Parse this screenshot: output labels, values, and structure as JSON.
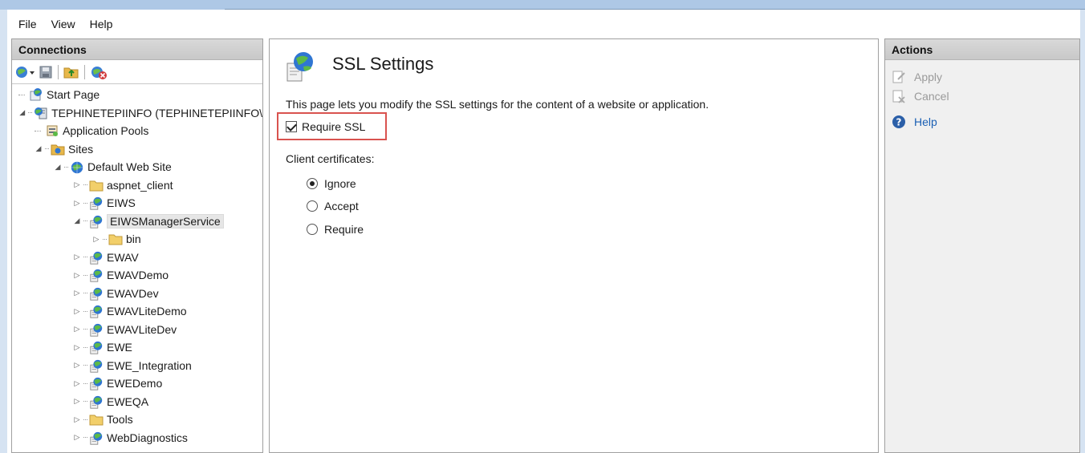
{
  "menu": [
    "File",
    "View",
    "Help"
  ],
  "connections": {
    "title": "Connections",
    "tree": [
      {
        "label": "Start Page",
        "level": 0,
        "icon": "start-page-icon",
        "expander": "none"
      },
      {
        "label": "TEPHINETEPIINFO (TEPHINETEPIINFO\\",
        "level": 0,
        "icon": "server-icon",
        "expander": "expanded"
      },
      {
        "label": "Application Pools",
        "level": 1,
        "icon": "app-pool-icon",
        "expander": "none"
      },
      {
        "label": "Sites",
        "level": 1,
        "icon": "sites-folder-icon",
        "expander": "expanded"
      },
      {
        "label": "Default Web Site",
        "level": 2,
        "icon": "globe-icon",
        "expander": "expanded"
      },
      {
        "label": "aspnet_client",
        "level": 3,
        "icon": "folder-icon",
        "expander": "collapsed"
      },
      {
        "label": "EIWS",
        "level": 3,
        "icon": "web-app-icon",
        "expander": "collapsed"
      },
      {
        "label": "EIWSManagerService",
        "level": 3,
        "icon": "web-app-icon",
        "expander": "expanded",
        "selected": true
      },
      {
        "label": "bin",
        "level": 4,
        "icon": "folder-icon",
        "expander": "collapsed"
      },
      {
        "label": "EWAV",
        "level": 3,
        "icon": "web-app-icon",
        "expander": "collapsed"
      },
      {
        "label": "EWAVDemo",
        "level": 3,
        "icon": "web-app-icon",
        "expander": "collapsed"
      },
      {
        "label": "EWAVDev",
        "level": 3,
        "icon": "web-app-icon",
        "expander": "collapsed"
      },
      {
        "label": "EWAVLiteDemo",
        "level": 3,
        "icon": "web-app-icon",
        "expander": "collapsed"
      },
      {
        "label": "EWAVLiteDev",
        "level": 3,
        "icon": "web-app-icon",
        "expander": "collapsed"
      },
      {
        "label": "EWE",
        "level": 3,
        "icon": "web-app-icon",
        "expander": "collapsed"
      },
      {
        "label": "EWE_Integration",
        "level": 3,
        "icon": "web-app-icon",
        "expander": "collapsed"
      },
      {
        "label": "EWEDemo",
        "level": 3,
        "icon": "web-app-icon",
        "expander": "collapsed"
      },
      {
        "label": "EWEQA",
        "level": 3,
        "icon": "web-app-icon",
        "expander": "collapsed"
      },
      {
        "label": "Tools",
        "level": 3,
        "icon": "folder-icon",
        "expander": "collapsed"
      },
      {
        "label": "WebDiagnostics",
        "level": 3,
        "icon": "web-app-icon",
        "expander": "collapsed"
      }
    ]
  },
  "center": {
    "title": "SSL Settings",
    "description": "This page lets you modify the SSL settings for the content of a website or application.",
    "require_ssl_label": "Require SSL",
    "require_ssl_checked": true,
    "client_certificates_label": "Client certificates:",
    "client_options": [
      {
        "label": "Ignore",
        "selected": true
      },
      {
        "label": "Accept",
        "selected": false
      },
      {
        "label": "Require",
        "selected": false
      }
    ]
  },
  "actions": {
    "title": "Actions",
    "apply_label": "Apply",
    "cancel_label": "Cancel",
    "help_label": "Help"
  },
  "colors": {
    "highlight_box": "#d9534f",
    "link": "#1a5fb4"
  }
}
